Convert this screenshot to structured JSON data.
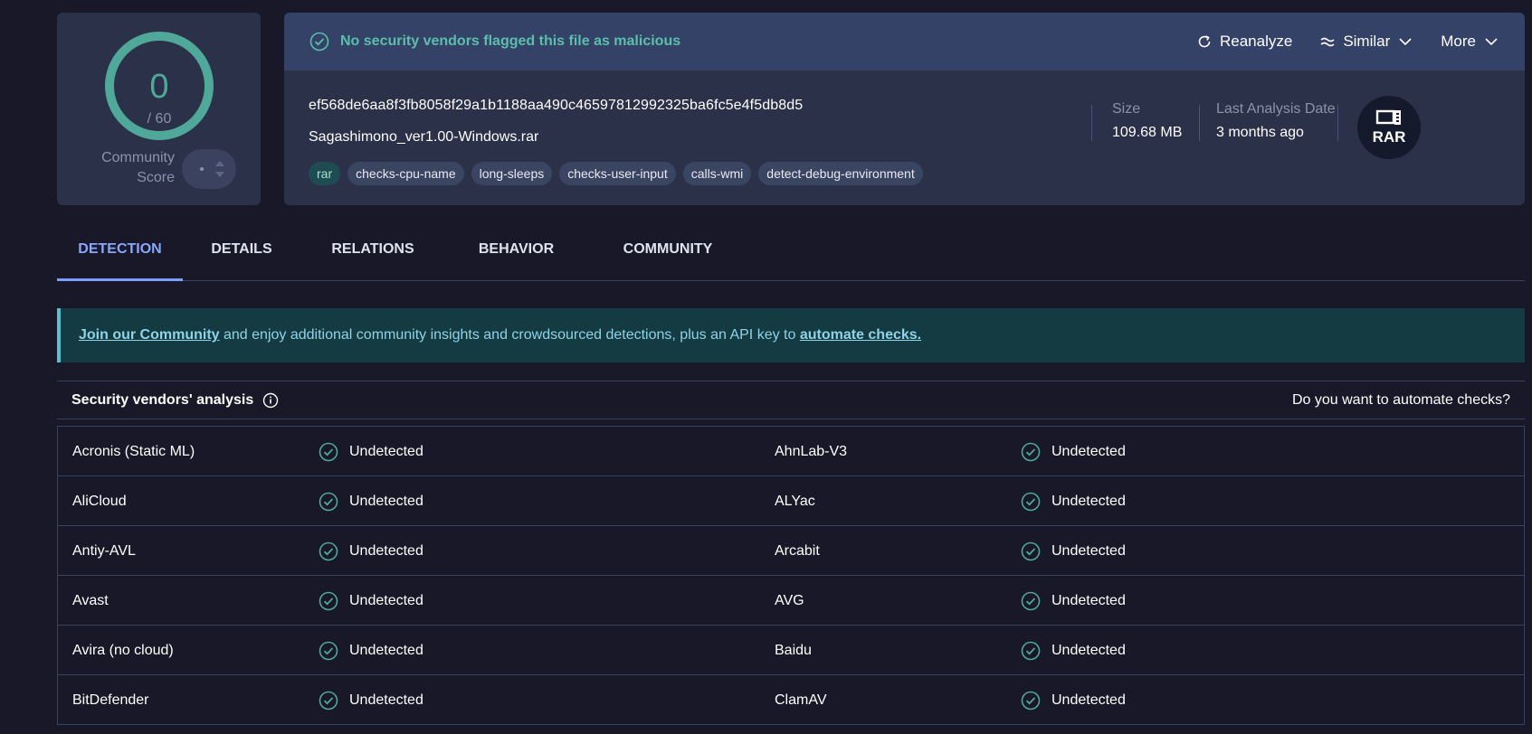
{
  "score": {
    "detections": "0",
    "total": "/ 60",
    "community_label_line1": "Community",
    "community_label_line2": "Score"
  },
  "banner": {
    "message": "No security vendors flagged this file as malicious",
    "reanalyze": "Reanalyze",
    "similar": "Similar",
    "more": "More"
  },
  "file": {
    "hash": "ef568de6aa8f3fb8058f29a1b1188aa490c46597812992325ba6fc5e4f5db8d5",
    "name": "Sagashimono_ver1.00-Windows.rar",
    "tags": [
      "rar",
      "checks-cpu-name",
      "long-sleeps",
      "checks-user-input",
      "calls-wmi",
      "detect-debug-environment"
    ],
    "size_label": "Size",
    "size_value": "109.68 MB",
    "date_label": "Last Analysis Date",
    "date_value": "3 months ago",
    "type_badge": "RAR"
  },
  "tabs": [
    "DETECTION",
    "DETAILS",
    "RELATIONS",
    "BEHAVIOR",
    "COMMUNITY"
  ],
  "notice": {
    "link1": "Join our Community",
    "text": " and enjoy additional community insights and crowdsourced detections, plus an API key to ",
    "link2": "automate checks."
  },
  "vendors": {
    "title": "Security vendors' analysis",
    "automate": "Do you want to automate checks?",
    "rows": [
      {
        "left": "Acronis (Static ML)",
        "left_result": "Undetected",
        "right": "AhnLab-V3",
        "right_result": "Undetected"
      },
      {
        "left": "AliCloud",
        "left_result": "Undetected",
        "right": "ALYac",
        "right_result": "Undetected"
      },
      {
        "left": "Antiy-AVL",
        "left_result": "Undetected",
        "right": "Arcabit",
        "right_result": "Undetected"
      },
      {
        "left": "Avast",
        "left_result": "Undetected",
        "right": "AVG",
        "right_result": "Undetected"
      },
      {
        "left": "Avira (no cloud)",
        "left_result": "Undetected",
        "right": "Baidu",
        "right_result": "Undetected"
      },
      {
        "left": "BitDefender",
        "left_result": "Undetected",
        "right": "ClamAV",
        "right_result": "Undetected"
      }
    ]
  },
  "colors": {
    "accent": "#4fa89a",
    "tab_active": "#8aa7ff",
    "background": "#181828",
    "card": "#2a3148"
  }
}
